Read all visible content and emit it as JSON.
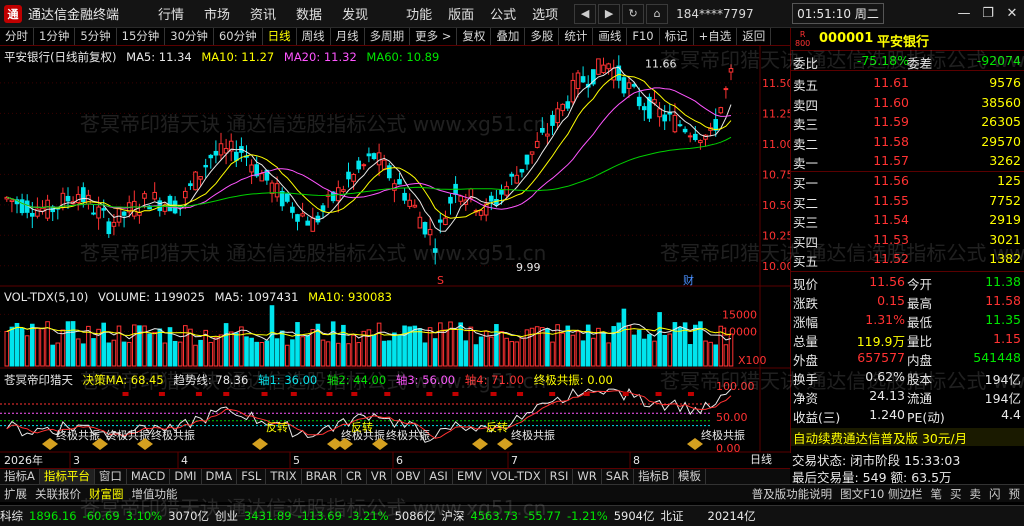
{
  "app": {
    "title": "通达信金融终端",
    "account": "184****7797",
    "clock": "01:51:10 周二"
  },
  "menu": [
    "行情",
    "市场",
    "资讯",
    "数据",
    "发现"
  ],
  "menu2": [
    "功能",
    "版面",
    "公式",
    "选项"
  ],
  "nav_icons": [
    "back-icon",
    "forward-icon",
    "refresh-icon",
    "home-icon"
  ],
  "window_controls": [
    "minimize-icon",
    "restore-icon",
    "close-icon"
  ],
  "toolbar": [
    {
      "label": "分时"
    },
    {
      "label": "1分钟"
    },
    {
      "label": "5分钟"
    },
    {
      "label": "15分钟"
    },
    {
      "label": "30分钟"
    },
    {
      "label": "60分钟"
    },
    {
      "label": "日线",
      "active": true
    },
    {
      "label": "周线"
    },
    {
      "label": "月线"
    },
    {
      "label": "多周期"
    },
    {
      "label": "更多 >"
    },
    {
      "label": "复权"
    },
    {
      "label": "叠加"
    },
    {
      "label": "多股"
    },
    {
      "label": "统计"
    },
    {
      "label": "画线"
    },
    {
      "label": "F10"
    },
    {
      "label": "标记"
    },
    {
      "label": "+自选"
    },
    {
      "label": "返回"
    }
  ],
  "main_chart": {
    "header": {
      "name": "平安银行(日线前复权)",
      "ma5": "MA5: 11.34",
      "ma10": "MA10: 11.27",
      "ma20": "MA20: 11.32",
      "ma60": "MA60: 10.89"
    },
    "price_high": "11.66",
    "price_low": "9.99",
    "axis_ticks": [
      "11.50",
      "11.25",
      "11.00",
      "10.75",
      "10.50",
      "10.25",
      "10.00"
    ],
    "mark_s": "S",
    "mark_cai": "财"
  },
  "volume": {
    "header": {
      "name": "VOL-TDX(5,10)",
      "volume": "VOLUME: 1199025",
      "ma5": "MA5: 1097431",
      "ma10": "MA10: 930083"
    },
    "axis_ticks": [
      "15000",
      "10000"
    ],
    "unit": "X100"
  },
  "indicator": {
    "header": {
      "name": "苍冥帝印猎天",
      "v1": "决策MA: 68.45",
      "v2": "趋势线: 78.36",
      "v3": "轴1: 36.00",
      "v4": "轴2: 44.00",
      "v5": "轴3: 56.00",
      "v6": "轴4: 71.00",
      "v7": "终极共振: 0.00"
    },
    "axis_ticks": [
      "100.00",
      "50.00",
      "0.00"
    ],
    "labels": [
      "终极共振",
      "终极共振",
      "终极共振",
      "反转",
      "终极共振",
      "反转",
      "终极共振",
      "反转",
      "终极共振",
      "终极共振"
    ]
  },
  "date_axis": {
    "year": "2026年",
    "months": [
      "3",
      "4",
      "5",
      "6",
      "7",
      "8"
    ],
    "period": "日线"
  },
  "right_panel": {
    "code": "000001",
    "name": "平安银行",
    "badge_top": "R",
    "badge_bottom": "800",
    "weibi": {
      "label": "委比",
      "value": "-75.18%",
      "label2": "委差",
      "value2": "-92074"
    },
    "sells": [
      {
        "label": "卖五",
        "price": "11.61",
        "vol": "9576"
      },
      {
        "label": "卖四",
        "price": "11.60",
        "vol": "38560"
      },
      {
        "label": "卖三",
        "price": "11.59",
        "vol": "26305"
      },
      {
        "label": "卖二",
        "price": "11.58",
        "vol": "29570"
      },
      {
        "label": "卖一",
        "price": "11.57",
        "vol": "3262"
      }
    ],
    "buys": [
      {
        "label": "买一",
        "price": "11.56",
        "vol": "125"
      },
      {
        "label": "买二",
        "price": "11.55",
        "vol": "7752"
      },
      {
        "label": "买三",
        "price": "11.54",
        "vol": "2919"
      },
      {
        "label": "买四",
        "price": "11.53",
        "vol": "3021"
      },
      {
        "label": "买五",
        "price": "11.52",
        "vol": "1382"
      }
    ],
    "stats": [
      {
        "l1": "现价",
        "v1": "11.56",
        "l2": "今开",
        "v2": "11.38"
      },
      {
        "l1": "涨跌",
        "v1": "0.15",
        "l2": "最高",
        "v2": "11.58"
      },
      {
        "l1": "涨幅",
        "v1": "1.31%",
        "l2": "最低",
        "v2": "11.35"
      },
      {
        "l1": "总量",
        "v1": "119.9万",
        "l2": "量比",
        "v2": "1.15"
      },
      {
        "l1": "外盘",
        "v1": "657577",
        "l2": "内盘",
        "v2": "541448"
      },
      {
        "l1": "换手",
        "v1": "0.62%",
        "l2": "股本",
        "v2": "194亿"
      },
      {
        "l1": "净资",
        "v1": "24.13",
        "l2": "流通",
        "v2": "194亿"
      },
      {
        "l1": "收益(三)",
        "v1": "1.240",
        "l2": "PE(动)",
        "v2": "4.4"
      }
    ],
    "ad": "自动续费通达信普及版 30元/月",
    "trade_status": "交易状态: 闭市阶段  15:33:03",
    "last_volume": "最后交易量: 549  额: 63.5万"
  },
  "tabs1": [
    {
      "label": "指标A"
    },
    {
      "label": "指标平台",
      "active": true
    },
    {
      "label": "窗口"
    },
    {
      "label": "MACD"
    },
    {
      "label": "DMI"
    },
    {
      "label": "DMA"
    },
    {
      "label": "FSL"
    },
    {
      "label": "TRIX"
    },
    {
      "label": "BRAR"
    },
    {
      "label": "CR"
    },
    {
      "label": "VR"
    },
    {
      "label": "OBV"
    },
    {
      "label": "ASI"
    },
    {
      "label": "EMV"
    },
    {
      "label": "VOL-TDX"
    },
    {
      "label": "RSI"
    },
    {
      "label": "WR"
    },
    {
      "label": "SAR"
    },
    {
      "label": "指标B"
    },
    {
      "label": "模板"
    }
  ],
  "tabs2": {
    "left": [
      {
        "label": "扩展"
      },
      {
        "label": "关联报价"
      },
      {
        "label": "财富圈"
      },
      {
        "label": "增值功能"
      }
    ],
    "right": [
      {
        "label": "普及版功能说明"
      },
      {
        "label": "图文F10 侧边栏"
      },
      {
        "label": "笔"
      },
      {
        "label": "买"
      },
      {
        "label": "卖"
      },
      {
        "label": "闪"
      },
      {
        "label": "预"
      }
    ]
  },
  "status": [
    {
      "name": "科综",
      "val": "1896.16",
      "chg": "-60.69",
      "pct": "3.10%",
      "amt": "3070亿"
    },
    {
      "name": "创业",
      "val": "3431.89",
      "chg": "-113.69",
      "pct": "-3.21%",
      "amt": "5086亿"
    },
    {
      "name": "沪深",
      "val": "4563.73",
      "chg": "-55.77",
      "pct": "-1.21%",
      "amt": "5904亿"
    },
    {
      "name": "北证",
      "val": "",
      "chg": "",
      "pct": "",
      "amt": "20214亿"
    }
  ],
  "watermark": [
    "苍冥帝印猎天诀 通达信选股指标公式 www.xg51.cn"
  ],
  "colors": {
    "up": "#ff3232",
    "down": "#00e5ee",
    "ma5": "#e8e8e8",
    "ma10": "#ffff00",
    "ma20": "#ff55ff",
    "ma60": "#00d000"
  }
}
